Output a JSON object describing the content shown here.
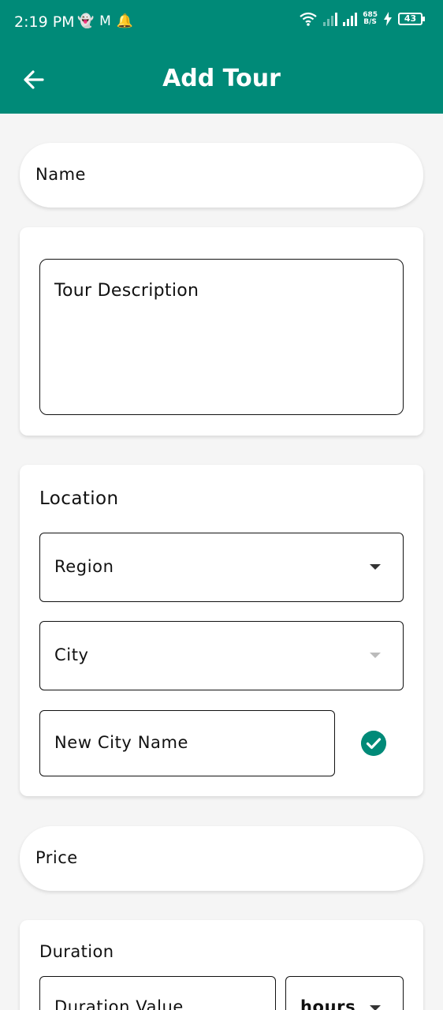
{
  "status_bar": {
    "time": "2:19 PM",
    "net_speed_top": "685",
    "net_speed_bottom": "B/S",
    "battery": "43",
    "icons": [
      "snapchat-icon",
      "gmail-icon",
      "notification-bell-icon",
      "wifi-icon",
      "signal-icon",
      "signal-icon",
      "charging-icon",
      "battery-icon"
    ]
  },
  "header": {
    "title": "Add Tour",
    "back_icon": "arrow-left-icon"
  },
  "form": {
    "name_placeholder": "Name",
    "description_placeholder": "Tour Description",
    "location": {
      "heading": "Location",
      "region_label": "Region",
      "city_label": "City",
      "new_city_placeholder": "New City Name",
      "confirm_icon": "check-circle-icon"
    },
    "price_placeholder": "Price",
    "duration": {
      "heading": "Duration",
      "value_placeholder": "Duration Value",
      "unit_value": "hours"
    }
  },
  "colors": {
    "primary": "#008a78",
    "background": "#f5f5f5",
    "card": "#ffffff"
  }
}
